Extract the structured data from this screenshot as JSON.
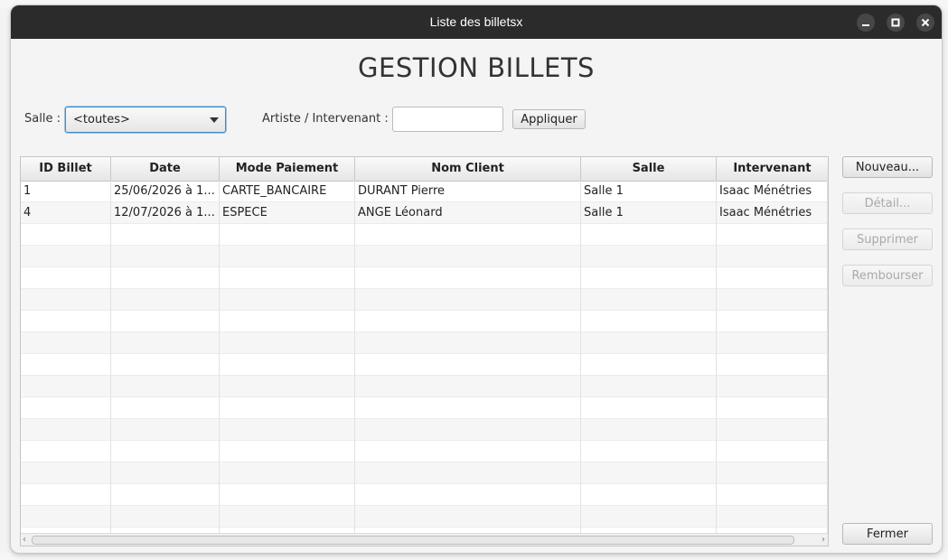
{
  "window": {
    "title": "Liste des billetsx"
  },
  "page_title": "GESTION BILLETS",
  "filters": {
    "salle_label": "Salle :",
    "salle_value": "<toutes>",
    "artiste_label": "Artiste / Intervenant :",
    "artiste_value": "",
    "apply_label": "Appliquer"
  },
  "table": {
    "columns": [
      "ID Billet",
      "Date",
      "Mode Paiement",
      "Nom Client",
      "Salle",
      "Intervenant"
    ],
    "rows": [
      [
        "1",
        "25/06/2026 à 1...",
        "CARTE_BANCAIRE",
        "DURANT Pierre",
        "Salle 1",
        "Isaac Ménétries"
      ],
      [
        "4",
        "12/07/2026 à 1...",
        "ESPECE",
        "ANGE Léonard",
        "Salle 1",
        "Isaac Ménétries"
      ]
    ],
    "empty_rows": 15
  },
  "actions": {
    "new": "Nouveau...",
    "detail": "Détail...",
    "delete": "Supprimer",
    "refund": "Rembourser",
    "close": "Fermer"
  },
  "icons": {
    "minimize": "minimize-icon",
    "maximize": "maximize-icon",
    "close": "close-icon",
    "dropdown": "chevron-down-icon"
  }
}
